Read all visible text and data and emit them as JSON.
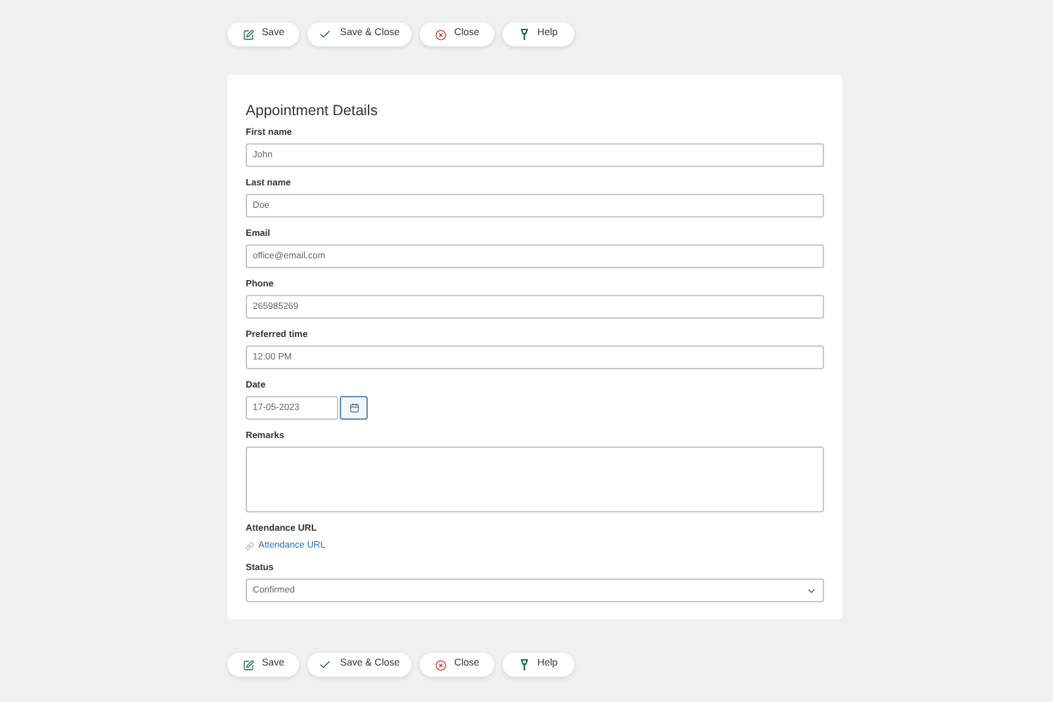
{
  "toolbar_top": [
    {
      "kind": "save",
      "label": "Save"
    },
    {
      "kind": "save_close",
      "label": "Save & Close"
    },
    {
      "kind": "close",
      "label": "Close"
    },
    {
      "kind": "help",
      "label": "Help"
    }
  ],
  "form": {
    "title": "Appointment Details",
    "fields": [
      {
        "kind": "text",
        "label": "First name",
        "value": "John"
      },
      {
        "kind": "text",
        "label": "Last name",
        "value": "Doe"
      },
      {
        "kind": "text",
        "label": "Email",
        "value": "office@email.com"
      },
      {
        "kind": "text",
        "label": "Phone",
        "value": "265985269"
      },
      {
        "kind": "text",
        "label": "Preferred time",
        "value": "12:00 PM"
      },
      {
        "kind": "date",
        "label": "Date",
        "value": "17-05-2023"
      },
      {
        "kind": "textarea",
        "label": "Remarks"
      },
      {
        "kind": "link",
        "label": "Attendance URL",
        "value": "Attendance URL"
      },
      {
        "kind": "select",
        "label": "Status",
        "value": "Confirmed"
      }
    ]
  },
  "toolbar_bottom": [
    {
      "kind": "save",
      "label": "Save"
    },
    {
      "kind": "save_close",
      "label": "Save & Close"
    },
    {
      "kind": "close",
      "label": "Close"
    },
    {
      "kind": "help",
      "label": "Help"
    }
  ]
}
